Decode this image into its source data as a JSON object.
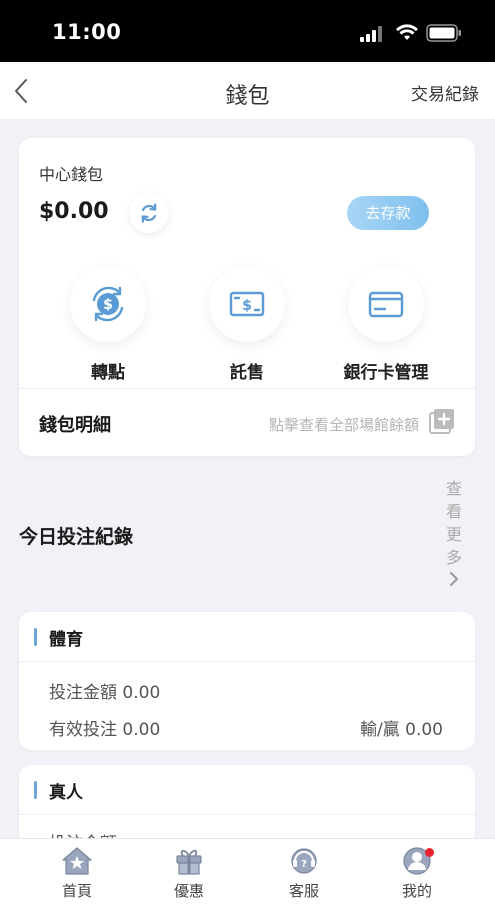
{
  "status_bar": {
    "time": "11:00"
  },
  "nav": {
    "title": "錢包",
    "right_link": "交易紀錄"
  },
  "wallet": {
    "label": "中心錢包",
    "balance": "$0.00",
    "deposit_label": "去存款",
    "actions": [
      {
        "label": "轉點",
        "icon": "transfer-coin-icon"
      },
      {
        "label": "託售",
        "icon": "cash-bill-icon"
      },
      {
        "label": "銀行卡管理",
        "icon": "bank-card-icon"
      }
    ],
    "detail_label": "錢包明細",
    "detail_hint": "點擊查看全部場館餘額"
  },
  "today": {
    "title": "今日投注紀錄",
    "view_more": [
      "查",
      "看",
      "更",
      "多"
    ]
  },
  "sections": {
    "sports": {
      "title": "體育",
      "bet_amount_label": "投注金額",
      "bet_amount_value": "0.00",
      "valid_bet_label": "有效投注",
      "valid_bet_value": "0.00",
      "win_loss_label": "輸/贏",
      "win_loss_value": "0.00"
    },
    "live": {
      "title": "真人",
      "bet_amount_label": "投注金額"
    }
  },
  "tabs": [
    {
      "label": "首頁",
      "icon": "home-icon"
    },
    {
      "label": "優惠",
      "icon": "gift-icon"
    },
    {
      "label": "客服",
      "icon": "support-icon"
    },
    {
      "label": "我的",
      "icon": "profile-icon"
    }
  ],
  "colors": {
    "accent": "#5b9bd5",
    "badge": "#e8242c"
  }
}
